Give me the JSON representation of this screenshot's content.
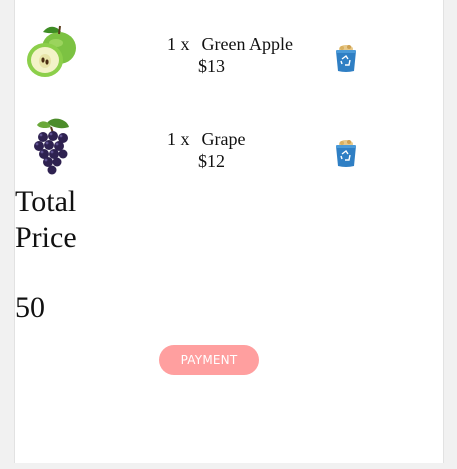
{
  "cart": {
    "items": [
      {
        "quantity": "1 x",
        "name": "Green Apple",
        "price": "$13",
        "image_icon": "green-apple-image",
        "delete_icon": "recycle-bin-icon"
      },
      {
        "quantity": "1 x",
        "name": "Grape",
        "price": "$12",
        "image_icon": "grape-image",
        "delete_icon": "recycle-bin-icon"
      }
    ],
    "total_label": "Total Price",
    "total_value": "50",
    "payment_button": "PAYMENT"
  },
  "colors": {
    "page_background": "#f1f1f1",
    "panel_background": "#ffffff",
    "payment_button": "#ff9f9f",
    "bin_blue": "#2f7fc4"
  }
}
